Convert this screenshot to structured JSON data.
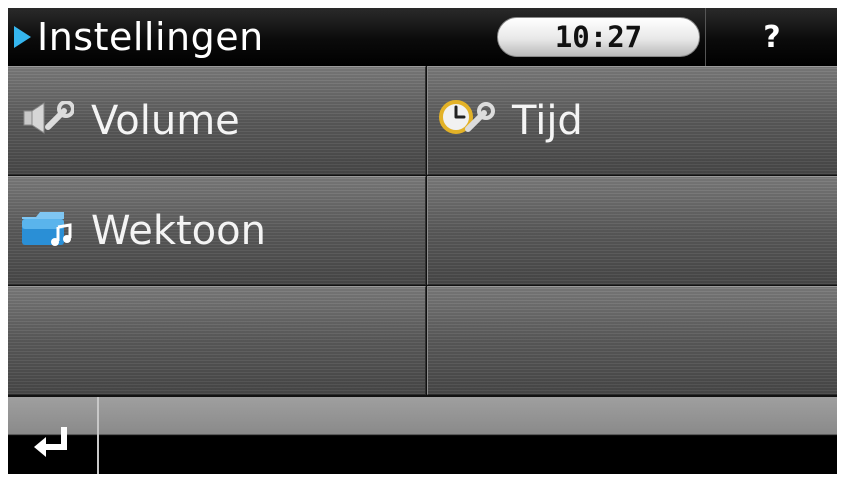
{
  "header": {
    "title": "Instellingen",
    "clock": "10:27",
    "help_label": "?"
  },
  "menu": {
    "items": [
      {
        "label": "Volume",
        "icon": "speaker-wrench-icon"
      },
      {
        "label": "Tijd",
        "icon": "clock-wrench-icon"
      },
      {
        "label": "Wektoon",
        "icon": "music-folder-icon"
      }
    ]
  },
  "footer": {
    "back_icon": "return-arrow-icon"
  },
  "colors": {
    "accent": "#35b6ef",
    "header_bg": "#000000",
    "tile_bg": "#5a5a5a",
    "text": "#ffffff"
  }
}
